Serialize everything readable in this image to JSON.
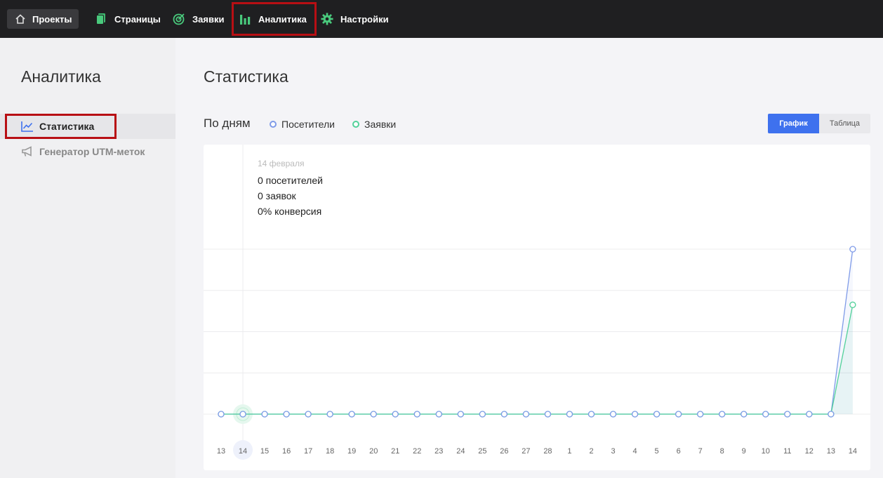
{
  "nav": {
    "projects": "Проекты",
    "pages": "Страницы",
    "leads": "Заявки",
    "analytics": "Аналитика",
    "settings": "Настройки"
  },
  "sidebar": {
    "title": "Аналитика",
    "items": [
      {
        "label": "Статистика"
      },
      {
        "label": "Генератор UTM-меток"
      }
    ]
  },
  "main": {
    "title": "Статистика",
    "period_label": "По дням",
    "legend": {
      "visitors": "Посетители",
      "leads": "Заявки"
    },
    "toggle": {
      "graph": "График",
      "table": "Таблица"
    },
    "tooltip": {
      "date": "14 февраля",
      "visitors": "0 посетителей",
      "leads": "0 заявок",
      "conversion": "0% конверсия"
    }
  },
  "colors": {
    "visitors": "#7f9be8",
    "leads": "#52d19a",
    "accent": "#3e71ee",
    "highlight": "#b80f14"
  },
  "chart_data": {
    "type": "line",
    "categories": [
      "13",
      "14",
      "15",
      "16",
      "17",
      "18",
      "19",
      "20",
      "21",
      "22",
      "23",
      "24",
      "25",
      "26",
      "27",
      "28",
      "1",
      "2",
      "3",
      "4",
      "5",
      "6",
      "7",
      "8",
      "9",
      "10",
      "11",
      "12",
      "13",
      "14"
    ],
    "series": [
      {
        "name": "Посетители",
        "values": [
          0,
          0,
          0,
          0,
          0,
          0,
          0,
          0,
          0,
          0,
          0,
          0,
          0,
          0,
          0,
          0,
          0,
          0,
          0,
          0,
          0,
          0,
          0,
          0,
          0,
          0,
          0,
          0,
          0,
          4
        ]
      },
      {
        "name": "Заявки",
        "values": [
          0,
          0,
          0,
          0,
          0,
          0,
          0,
          0,
          0,
          0,
          0,
          0,
          0,
          0,
          0,
          0,
          0,
          0,
          0,
          0,
          0,
          0,
          0,
          0,
          0,
          0,
          0,
          0,
          0,
          2.65
        ]
      }
    ],
    "ylim": [
      0,
      4
    ],
    "grid": true,
    "selected_index": 1
  }
}
